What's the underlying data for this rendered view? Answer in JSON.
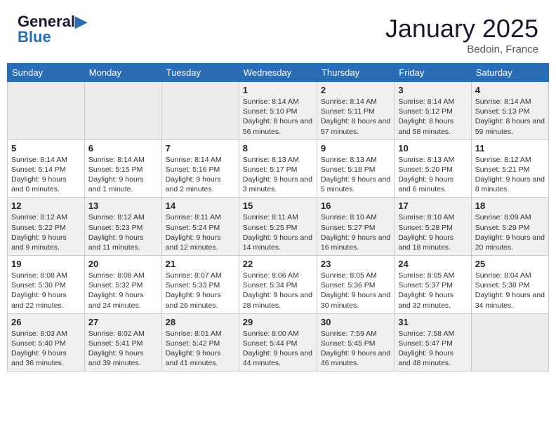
{
  "header": {
    "logo_line1": "General",
    "logo_line2": "Blue",
    "month": "January 2025",
    "location": "Bedoin, France"
  },
  "days_of_week": [
    "Sunday",
    "Monday",
    "Tuesday",
    "Wednesday",
    "Thursday",
    "Friday",
    "Saturday"
  ],
  "weeks": [
    [
      {
        "day": "",
        "info": ""
      },
      {
        "day": "",
        "info": ""
      },
      {
        "day": "",
        "info": ""
      },
      {
        "day": "1",
        "info": "Sunrise: 8:14 AM\nSunset: 5:10 PM\nDaylight: 8 hours and 56 minutes."
      },
      {
        "day": "2",
        "info": "Sunrise: 8:14 AM\nSunset: 5:11 PM\nDaylight: 8 hours and 57 minutes."
      },
      {
        "day": "3",
        "info": "Sunrise: 8:14 AM\nSunset: 5:12 PM\nDaylight: 8 hours and 58 minutes."
      },
      {
        "day": "4",
        "info": "Sunrise: 8:14 AM\nSunset: 5:13 PM\nDaylight: 8 hours and 59 minutes."
      }
    ],
    [
      {
        "day": "5",
        "info": "Sunrise: 8:14 AM\nSunset: 5:14 PM\nDaylight: 9 hours and 0 minutes."
      },
      {
        "day": "6",
        "info": "Sunrise: 8:14 AM\nSunset: 5:15 PM\nDaylight: 9 hours and 1 minute."
      },
      {
        "day": "7",
        "info": "Sunrise: 8:14 AM\nSunset: 5:16 PM\nDaylight: 9 hours and 2 minutes."
      },
      {
        "day": "8",
        "info": "Sunrise: 8:13 AM\nSunset: 5:17 PM\nDaylight: 9 hours and 3 minutes."
      },
      {
        "day": "9",
        "info": "Sunrise: 8:13 AM\nSunset: 5:18 PM\nDaylight: 9 hours and 5 minutes."
      },
      {
        "day": "10",
        "info": "Sunrise: 8:13 AM\nSunset: 5:20 PM\nDaylight: 9 hours and 6 minutes."
      },
      {
        "day": "11",
        "info": "Sunrise: 8:12 AM\nSunset: 5:21 PM\nDaylight: 9 hours and 8 minutes."
      }
    ],
    [
      {
        "day": "12",
        "info": "Sunrise: 8:12 AM\nSunset: 5:22 PM\nDaylight: 9 hours and 9 minutes."
      },
      {
        "day": "13",
        "info": "Sunrise: 8:12 AM\nSunset: 5:23 PM\nDaylight: 9 hours and 11 minutes."
      },
      {
        "day": "14",
        "info": "Sunrise: 8:11 AM\nSunset: 5:24 PM\nDaylight: 9 hours and 12 minutes."
      },
      {
        "day": "15",
        "info": "Sunrise: 8:11 AM\nSunset: 5:25 PM\nDaylight: 9 hours and 14 minutes."
      },
      {
        "day": "16",
        "info": "Sunrise: 8:10 AM\nSunset: 5:27 PM\nDaylight: 9 hours and 16 minutes."
      },
      {
        "day": "17",
        "info": "Sunrise: 8:10 AM\nSunset: 5:28 PM\nDaylight: 9 hours and 18 minutes."
      },
      {
        "day": "18",
        "info": "Sunrise: 8:09 AM\nSunset: 5:29 PM\nDaylight: 9 hours and 20 minutes."
      }
    ],
    [
      {
        "day": "19",
        "info": "Sunrise: 8:08 AM\nSunset: 5:30 PM\nDaylight: 9 hours and 22 minutes."
      },
      {
        "day": "20",
        "info": "Sunrise: 8:08 AM\nSunset: 5:32 PM\nDaylight: 9 hours and 24 minutes."
      },
      {
        "day": "21",
        "info": "Sunrise: 8:07 AM\nSunset: 5:33 PM\nDaylight: 9 hours and 26 minutes."
      },
      {
        "day": "22",
        "info": "Sunrise: 8:06 AM\nSunset: 5:34 PM\nDaylight: 9 hours and 28 minutes."
      },
      {
        "day": "23",
        "info": "Sunrise: 8:05 AM\nSunset: 5:36 PM\nDaylight: 9 hours and 30 minutes."
      },
      {
        "day": "24",
        "info": "Sunrise: 8:05 AM\nSunset: 5:37 PM\nDaylight: 9 hours and 32 minutes."
      },
      {
        "day": "25",
        "info": "Sunrise: 8:04 AM\nSunset: 5:38 PM\nDaylight: 9 hours and 34 minutes."
      }
    ],
    [
      {
        "day": "26",
        "info": "Sunrise: 8:03 AM\nSunset: 5:40 PM\nDaylight: 9 hours and 36 minutes."
      },
      {
        "day": "27",
        "info": "Sunrise: 8:02 AM\nSunset: 5:41 PM\nDaylight: 9 hours and 39 minutes."
      },
      {
        "day": "28",
        "info": "Sunrise: 8:01 AM\nSunset: 5:42 PM\nDaylight: 9 hours and 41 minutes."
      },
      {
        "day": "29",
        "info": "Sunrise: 8:00 AM\nSunset: 5:44 PM\nDaylight: 9 hours and 44 minutes."
      },
      {
        "day": "30",
        "info": "Sunrise: 7:59 AM\nSunset: 5:45 PM\nDaylight: 9 hours and 46 minutes."
      },
      {
        "day": "31",
        "info": "Sunrise: 7:58 AM\nSunset: 5:47 PM\nDaylight: 9 hours and 48 minutes."
      },
      {
        "day": "",
        "info": ""
      }
    ]
  ]
}
